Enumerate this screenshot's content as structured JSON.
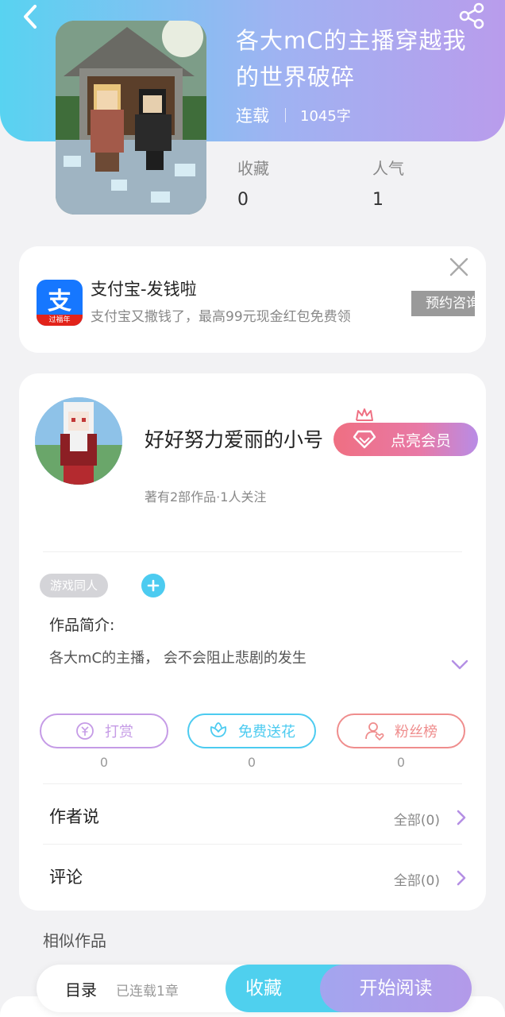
{
  "header": {
    "back_icon": "chevron-left-icon",
    "share_icon": "share-icon",
    "cover_alt": "",
    "title": "各大mC的主播穿越我的世界破碎",
    "serial_status": "连载",
    "word_count": "1045字",
    "stats": [
      {
        "label": "收藏",
        "value": "0"
      },
      {
        "label": "人气",
        "value": "1"
      }
    ]
  },
  "ad": {
    "title": "支付宝-发钱啦",
    "description": "支付宝又撒钱了，最高99元现金红包免费领",
    "button": "预约咨询",
    "logo_char": "支",
    "logo_sub": "过福年",
    "close_icon": "close-icon"
  },
  "author": {
    "name": "好好努力爱丽的小号",
    "vip_button": "点亮会员",
    "meta": "著有2部作品·1人关注"
  },
  "book": {
    "tag": "游戏同人",
    "intro_label": "作品简介:",
    "intro_text": "各大mC的主播， 会不会阻止悲剧的发生"
  },
  "actions": [
    {
      "label": "打赏",
      "count": "0",
      "icon": "coin-icon",
      "color": "#c59be6"
    },
    {
      "label": "免费送花",
      "count": "0",
      "icon": "flower-icon",
      "color": "#4ccbf0"
    },
    {
      "label": "粉丝榜",
      "count": "0",
      "icon": "fans-icon",
      "color": "#ef8d8d"
    }
  ],
  "sections": [
    {
      "label": "作者说",
      "right": "全部(0)"
    },
    {
      "label": "评论",
      "right": "全部(0)"
    }
  ],
  "similar_title": "相似作品",
  "bottom_bar": {
    "toc": "目录",
    "toc_sub": "已连载1章",
    "favorite": "收藏",
    "read": "开始阅读"
  },
  "colors": {
    "header_gradient_start": "#58d3f1",
    "header_gradient_end": "#b99cec",
    "accent_cyan": "#4fd0ee",
    "accent_purple": "#b39ae9",
    "vip_pink": "#ef6f82"
  }
}
